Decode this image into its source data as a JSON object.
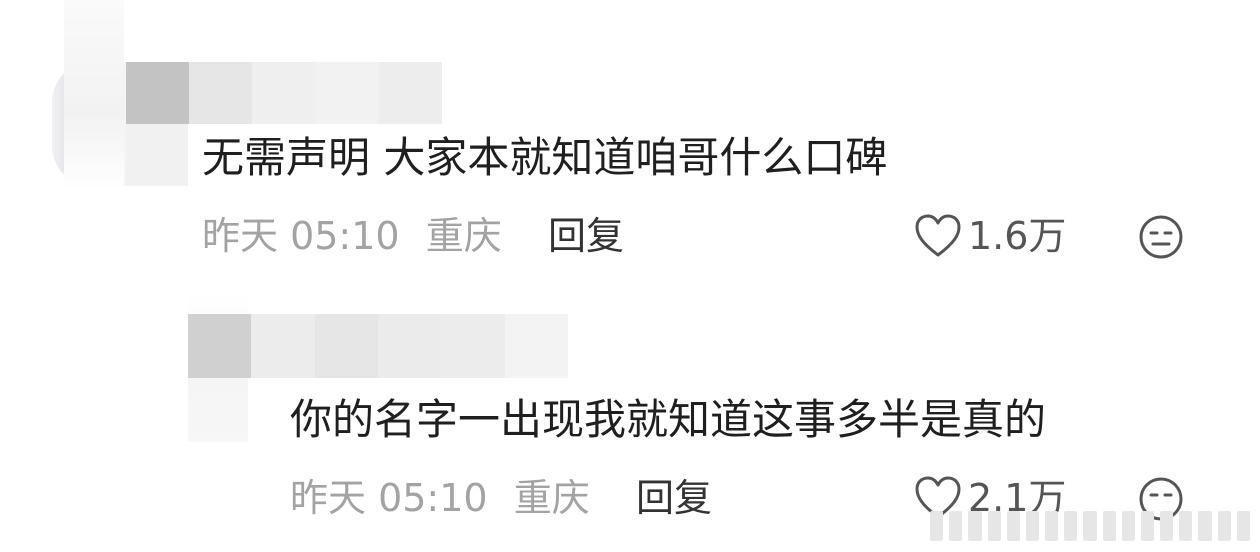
{
  "comments": [
    {
      "text": "无需声明 大家本就知道咱哥什么口碑",
      "time": "昨天 05:10",
      "location": "重庆",
      "reply_label": "回复",
      "likes": "1.6万"
    },
    {
      "text": "你的名字一出现我就知道这事多半是真的",
      "time": "昨天 05:10",
      "location": "重庆",
      "reply_label": "回复",
      "likes": "2.1万"
    }
  ],
  "icons": {
    "like": "heart-outline-icon",
    "dislike": "meh-face-icon"
  }
}
